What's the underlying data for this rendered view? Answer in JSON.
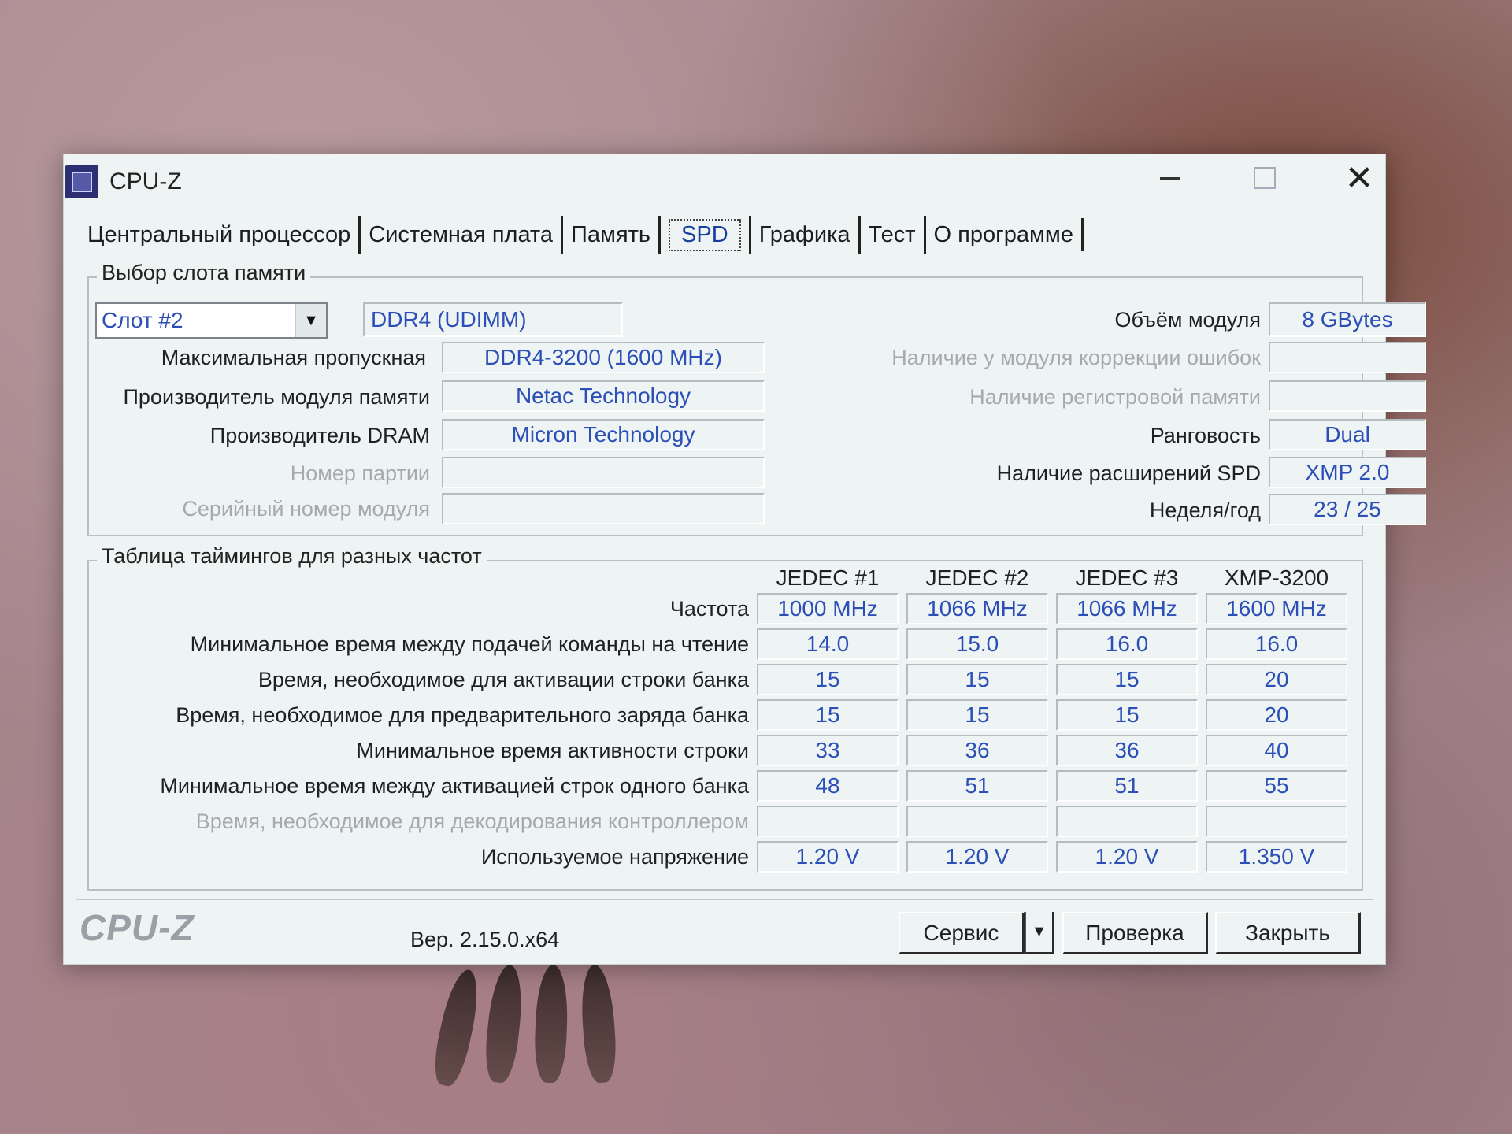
{
  "window": {
    "title": "CPU-Z",
    "close_glyph": "✕"
  },
  "tabs": [
    {
      "label": "Центральный процессор"
    },
    {
      "label": "Системная плата"
    },
    {
      "label": "Память"
    },
    {
      "label": "SPD",
      "active": true
    },
    {
      "label": "Графика"
    },
    {
      "label": "Тест"
    },
    {
      "label": "О программе"
    }
  ],
  "slot": {
    "group_title": "Выбор слота памяти",
    "selected": "Слот #2",
    "type": "DDR4 (UDIMM)",
    "module_size_label": "Объём модуля",
    "module_size": "8 GBytes",
    "max_bandwidth_label": "Максимальная пропускная",
    "max_bandwidth": "DDR4-3200 (1600 MHz)",
    "ecc_label": "Наличие у модуля коррекции ошибок",
    "ecc": "",
    "module_manuf_label": "Производитель модуля памяти",
    "module_manuf": "Netac Technology",
    "registered_label": "Наличие регистровой памяти",
    "registered": "",
    "dram_manuf_label": "Производитель DRAM",
    "dram_manuf": "Micron Technology",
    "ranks_label": "Ранговость",
    "ranks": "Dual",
    "part_label": "Номер партии",
    "part": "",
    "spd_ext_label": "Наличие расширений SPD",
    "spd_ext": "XMP 2.0",
    "serial_label": "Серийный номер модуля",
    "serial": "",
    "week_year_label": "Неделя/год",
    "week_year": "23 / 25"
  },
  "timings": {
    "group_title": "Таблица таймингов для разных частот",
    "columns": [
      "JEDEC #1",
      "JEDEC #2",
      "JEDEC #3",
      "XMP-3200"
    ],
    "rows": [
      {
        "label": "Частота",
        "values": [
          "1000 MHz",
          "1066 MHz",
          "1066 MHz",
          "1600 MHz"
        ]
      },
      {
        "label": "Минимальное время между подачей команды на чтение",
        "values": [
          "14.0",
          "15.0",
          "16.0",
          "16.0"
        ]
      },
      {
        "label": "Время, необходимое для активации строки банка",
        "values": [
          "15",
          "15",
          "15",
          "20"
        ]
      },
      {
        "label": "Время, необходимое для предварительного заряда банка",
        "values": [
          "15",
          "15",
          "15",
          "20"
        ]
      },
      {
        "label": "Минимальное время активности строки",
        "values": [
          "33",
          "36",
          "36",
          "40"
        ]
      },
      {
        "label": "Минимальное время между активацией строк одного банка",
        "values": [
          "48",
          "51",
          "51",
          "55"
        ]
      },
      {
        "label": "Время, необходимое для декодирования контроллером",
        "values": [
          "",
          "",
          "",
          ""
        ],
        "dim": true
      },
      {
        "label": "Используемое напряжение",
        "values": [
          "1.20 V",
          "1.20 V",
          "1.20 V",
          "1.350 V"
        ]
      }
    ]
  },
  "footer": {
    "logo": "CPU-Z",
    "version": "Вер. 2.15.0.x64",
    "service_label": "Сервис",
    "validate_label": "Проверка",
    "close_label": "Закрыть"
  }
}
